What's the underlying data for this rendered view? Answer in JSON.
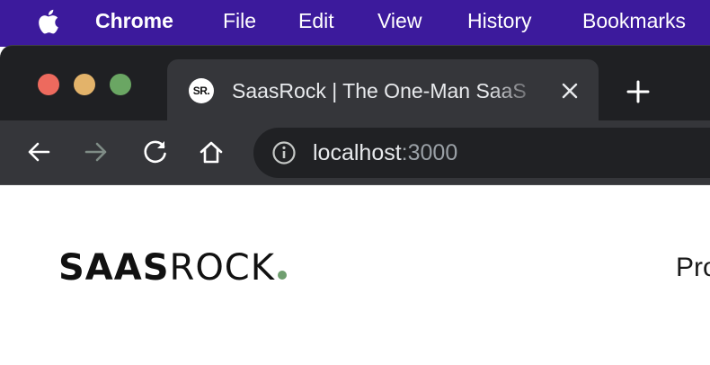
{
  "menubar": {
    "app": "Chrome",
    "items": [
      "File",
      "Edit",
      "View",
      "History",
      "Bookmarks"
    ]
  },
  "tab": {
    "favicon_text": "SR.",
    "title": "SaasRock | The One-Man SaaS"
  },
  "address_bar": {
    "host": "localhost",
    "port": ":3000"
  },
  "page": {
    "logo_strong": "SAAS",
    "logo_light": "ROCK",
    "nav_partial": "Pro"
  },
  "colors": {
    "menubar": "#3c1a9c",
    "tabstrip": "#1f2023",
    "toolbar": "#35363a",
    "logo_dot": "#6f9e6f"
  }
}
